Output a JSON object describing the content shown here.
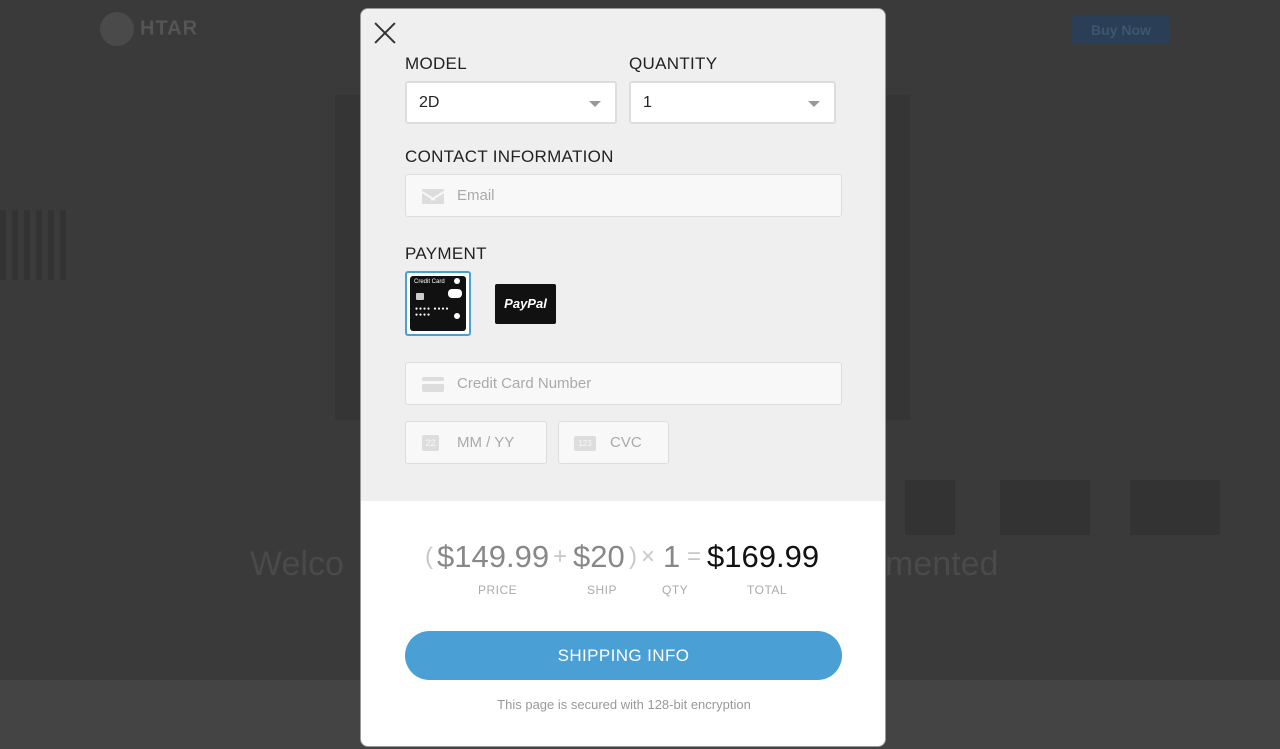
{
  "background": {
    "logo_text": "HTAR",
    "buy_button": "Buy Now",
    "welcome_left": "Welco",
    "welcome_right": "mented"
  },
  "modal": {
    "model_label": "MODEL",
    "model_value": "2D",
    "quantity_label": "QUANTITY",
    "quantity_value": "1",
    "contact_label": "CONTACT INFORMATION",
    "email_placeholder": "Email",
    "payment_label": "PAYMENT",
    "payment_options": [
      {
        "name": "Credit Card",
        "selected": true
      },
      {
        "name": "PayPal",
        "selected": false
      }
    ],
    "card_number_placeholder": "Credit Card Number",
    "expiry_placeholder": "MM / YY",
    "cvc_placeholder": "CVC",
    "calendar_icon_text": "22",
    "cvc_icon_text": "123"
  },
  "summary": {
    "open_paren": "(",
    "price": "$149.99",
    "plus": "+",
    "ship": "$20",
    "close_paren": ")",
    "times": "×",
    "qty": "1",
    "equals": "=",
    "total": "$169.99",
    "price_caption": "PRICE",
    "ship_caption": "SHIP",
    "qty_caption": "QTY",
    "total_caption": "TOTAL"
  },
  "actions": {
    "shipping_button": "SHIPPING INFO",
    "security_note": "This page is secured with 128-bit encryption"
  },
  "colors": {
    "accent": "#4a9fd5",
    "overlay": "#3a3a3a"
  }
}
